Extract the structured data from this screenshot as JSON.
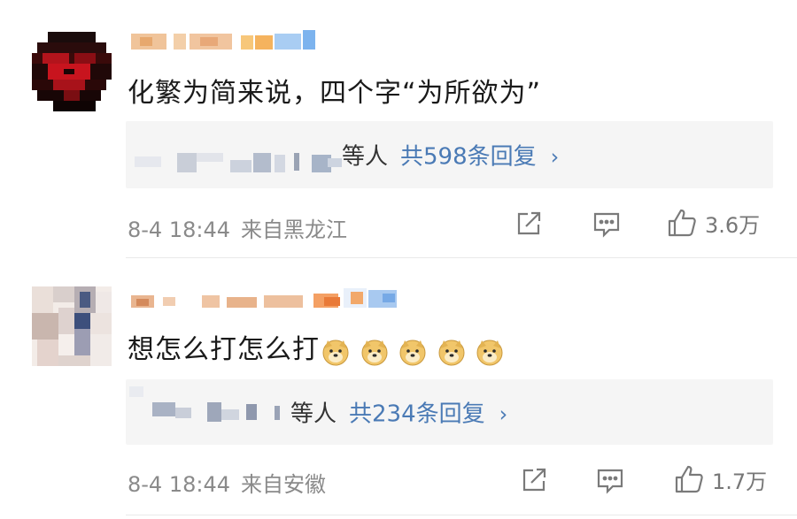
{
  "comments": [
    {
      "text": "化繁为简来说，四个字“为所欲为”",
      "reply_others": "等人",
      "reply_count": "共598条回复",
      "reply_chevron": "›",
      "time": "8-4 18:44",
      "location": "来自黑龙江",
      "likes": "3.6万"
    },
    {
      "text": "想怎么打怎么打",
      "emoji_count": 5,
      "reply_others": "等人",
      "reply_count": "共234条回复",
      "reply_chevron": "›",
      "time": "8-4 18:44",
      "location": "来自安徽",
      "likes": "1.7万"
    }
  ],
  "icons": {
    "share": "share-icon",
    "comment": "comment-icon",
    "like": "thumbs-up-icon",
    "emoji": "doge-emoji-icon"
  },
  "colors": {
    "link_blue": "#4a7ab5",
    "meta_gray": "#8a8a8a",
    "reply_bg": "#f5f5f5"
  }
}
